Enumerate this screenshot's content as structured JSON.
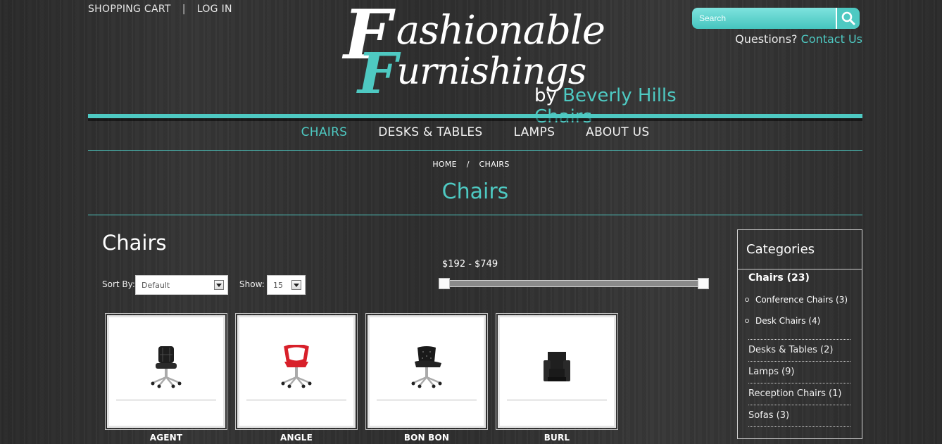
{
  "header": {
    "shopping_cart": "SHOPPING CART",
    "separator": "|",
    "log_in": "LOG IN",
    "logo": {
      "line1": "Fashionable",
      "line2": "Furnishings",
      "by": "by",
      "brand": "Beverly Hills Chairs"
    },
    "search": {
      "placeholder": "Search"
    },
    "questions": "Questions?",
    "contact_link": "Contact Us"
  },
  "nav": {
    "items": [
      {
        "label": "CHAIRS",
        "active": true
      },
      {
        "label": "DESKS & TABLES",
        "active": false
      },
      {
        "label": "LAMPS",
        "active": false
      },
      {
        "label": "ABOUT US",
        "active": false
      }
    ]
  },
  "breadcrumb": {
    "home": "HOME",
    "separator": "/",
    "current": "CHAIRS"
  },
  "page_heading": "Chairs",
  "main": {
    "title": "Chairs",
    "sort_label": "Sort By:",
    "sort_value": "Default",
    "show_label": "Show:",
    "show_value": "15",
    "price_range": "$192  -  $749",
    "price_min": 192,
    "price_max": 749
  },
  "products": [
    {
      "name": "AGENT",
      "icon": "black-office-chair-icon",
      "color": "#222222"
    },
    {
      "name": "ANGLE",
      "icon": "red-office-chair-icon",
      "color": "#d8202a"
    },
    {
      "name": "BON BON",
      "icon": "black-tufted-chair-icon",
      "color": "#1a1a1a"
    },
    {
      "name": "BURL",
      "icon": "black-armchair-icon",
      "color": "#1f1f1f"
    }
  ],
  "sidebar": {
    "title": "Categories",
    "main_category": "Chairs (23)",
    "sub_categories": [
      "Conference Chairs (3)",
      "Desk Chairs (4)"
    ],
    "categories": [
      "Desks & Tables (2)",
      "Lamps (9)",
      "Reception Chairs (1)",
      "Sofas (3)"
    ]
  },
  "colors": {
    "accent": "#4ec9c2",
    "background": "#2f2f2f",
    "text": "#ffffff"
  }
}
